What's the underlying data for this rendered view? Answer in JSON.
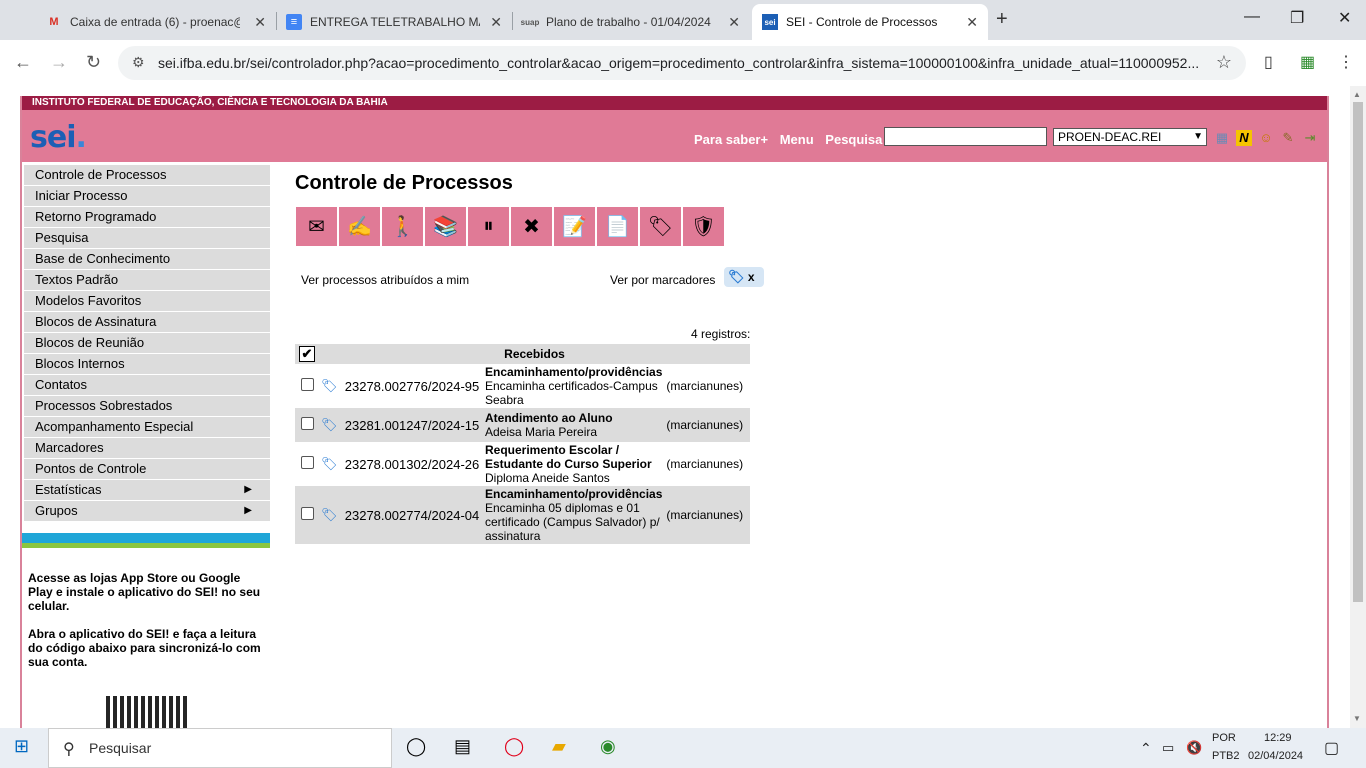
{
  "browser": {
    "tabs": [
      {
        "favicon": "M",
        "title": "Caixa de entrada (6) - proenac@",
        "close": "✕"
      },
      {
        "favicon": "≡",
        "title": "ENTREGA TELETRABALHO MAR",
        "close": "✕"
      },
      {
        "favicon": "suap",
        "title": "Plano de trabalho - 01/04/2024",
        "close": "✕"
      },
      {
        "favicon": "sei",
        "title": "SEI - Controle de Processos",
        "close": "✕"
      }
    ],
    "new_tab": "+",
    "url": "sei.ifba.edu.br/sei/controlador.php?acao=procedimento_controlar&acao_origem=procedimento_controlar&infra_sistema=100000100&infra_unidade_atual=110000952..."
  },
  "sei": {
    "institution": "INSTITUTO FEDERAL DE EDUCAÇÃO, CIÊNCIA E TECNOLOGIA DA BAHIA",
    "logo": "sei",
    "logo_suffix": ".",
    "header_links": [
      "Para saber+",
      "Menu",
      "Pesquisa"
    ],
    "search_value": "",
    "unit_select": "PROEN-DEAC.REI",
    "header_icons": [
      "grid-icon",
      "new-icon",
      "user-icon",
      "tools-icon",
      "exit-icon"
    ],
    "menu": [
      {
        "label": "Controle de Processos"
      },
      {
        "label": "Iniciar Processo"
      },
      {
        "label": "Retorno Programado"
      },
      {
        "label": "Pesquisa"
      },
      {
        "label": "Base de Conhecimento"
      },
      {
        "label": "Textos Padrão"
      },
      {
        "label": "Modelos Favoritos"
      },
      {
        "label": "Blocos de Assinatura"
      },
      {
        "label": "Blocos de Reunião"
      },
      {
        "label": "Blocos Internos"
      },
      {
        "label": "Contatos"
      },
      {
        "label": "Processos Sobrestados"
      },
      {
        "label": "Acompanhamento Especial"
      },
      {
        "label": "Marcadores"
      },
      {
        "label": "Pontos de Controle"
      },
      {
        "label": "Estatísticas",
        "submenu": true
      },
      {
        "label": "Grupos",
        "submenu": true
      }
    ],
    "app_text_1": "Acesse as lojas App Store ou Google Play e instale o aplicativo do SEI! no seu celular.",
    "app_text_2": "Abra o aplicativo do SEI! e faça a leitura do código abaixo para sincronizá-lo com sua conta.",
    "page_title": "Controle de Processos",
    "toolbar_icons": [
      "send-process-icon",
      "sign-icon",
      "assign-icon",
      "document-icon",
      "suspend-icon",
      "conclude-icon",
      "annotate-icon",
      "new-document-icon",
      "marker-icon",
      "follow-icon"
    ],
    "assigned_link": "Ver processos atribuídos a mim",
    "markers_label": "Ver por marcadores",
    "markers_clear": "x",
    "records_count": "4 registros:",
    "table_header": "Recebidos",
    "processes": [
      {
        "number": "23278.002776/2024-95",
        "type": "Encaminhamento/providências",
        "desc": "Encaminha certificados-Campus Seabra",
        "user": "(marcianunes)"
      },
      {
        "number": "23281.001247/2024-15",
        "type": "Atendimento ao Aluno",
        "desc": "Adeisa Maria Pereira",
        "user": "(marcianunes)"
      },
      {
        "number": "23278.001302/2024-26",
        "type": "Requerimento Escolar / Estudante do Curso Superior",
        "desc": "Diploma Aneide Santos",
        "user": "(marcianunes)"
      },
      {
        "number": "23278.002774/2024-04",
        "type": "Encaminhamento/providências",
        "desc": "Encaminha 05 diplomas e 01 certificado (Campus Salvador) p/ assinatura",
        "user": "(marcianunes)"
      }
    ]
  },
  "taskbar": {
    "search_placeholder": "Pesquisar",
    "lang": "POR",
    "layout": "PTB2",
    "time": "12:29",
    "date": "02/04/2024"
  }
}
